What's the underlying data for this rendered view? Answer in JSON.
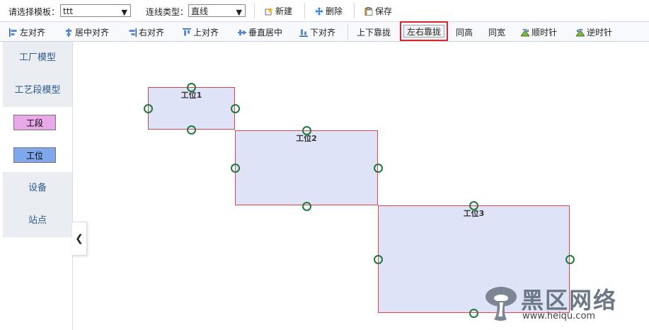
{
  "toolbar1": {
    "template_label": "请选择模板：",
    "template_value": "ttt",
    "line_type_label": "连线类型：",
    "line_type_value": "直线",
    "new_label": "新建",
    "delete_label": "删除",
    "save_label": "保存"
  },
  "toolbar2": {
    "items": [
      {
        "label": "左对齐",
        "icon": "align-left-icon"
      },
      {
        "label": "居中对齐",
        "icon": "align-center-icon"
      },
      {
        "label": "右对齐",
        "icon": "align-right-icon"
      },
      {
        "label": "上对齐",
        "icon": "align-top-icon"
      },
      {
        "label": "垂直居中",
        "icon": "align-middle-icon"
      },
      {
        "label": "下对齐",
        "icon": "align-bottom-icon"
      },
      {
        "label": "上下靠拢"
      },
      {
        "label": "左右靠拢"
      },
      {
        "label": "同高"
      },
      {
        "label": "同宽"
      },
      {
        "label": "顺时针",
        "icon": "rotate-cw-icon"
      },
      {
        "label": "逆时针",
        "icon": "rotate-ccw-icon"
      }
    ],
    "highlighted_index": 7
  },
  "sidebar": {
    "factory_model": "工厂模型",
    "process_model": "工艺段模型",
    "segment_item": "工段",
    "station_item": "工位",
    "equipment": "设备",
    "site": "站点"
  },
  "canvas": {
    "nodes": [
      {
        "title": "工位1"
      },
      {
        "title": "工位2"
      },
      {
        "title": "工位3"
      }
    ]
  },
  "watermark": {
    "text": "黑区网络",
    "url": "www.heiqu.com"
  },
  "colors": {
    "node_fill": "#dfe3f7",
    "node_border": "#d7484e",
    "anchor": "#1f7a3e",
    "segment_fill": "#e9a8e8",
    "station_fill": "#7fa8ec",
    "highlight_border": "#e0232a"
  }
}
